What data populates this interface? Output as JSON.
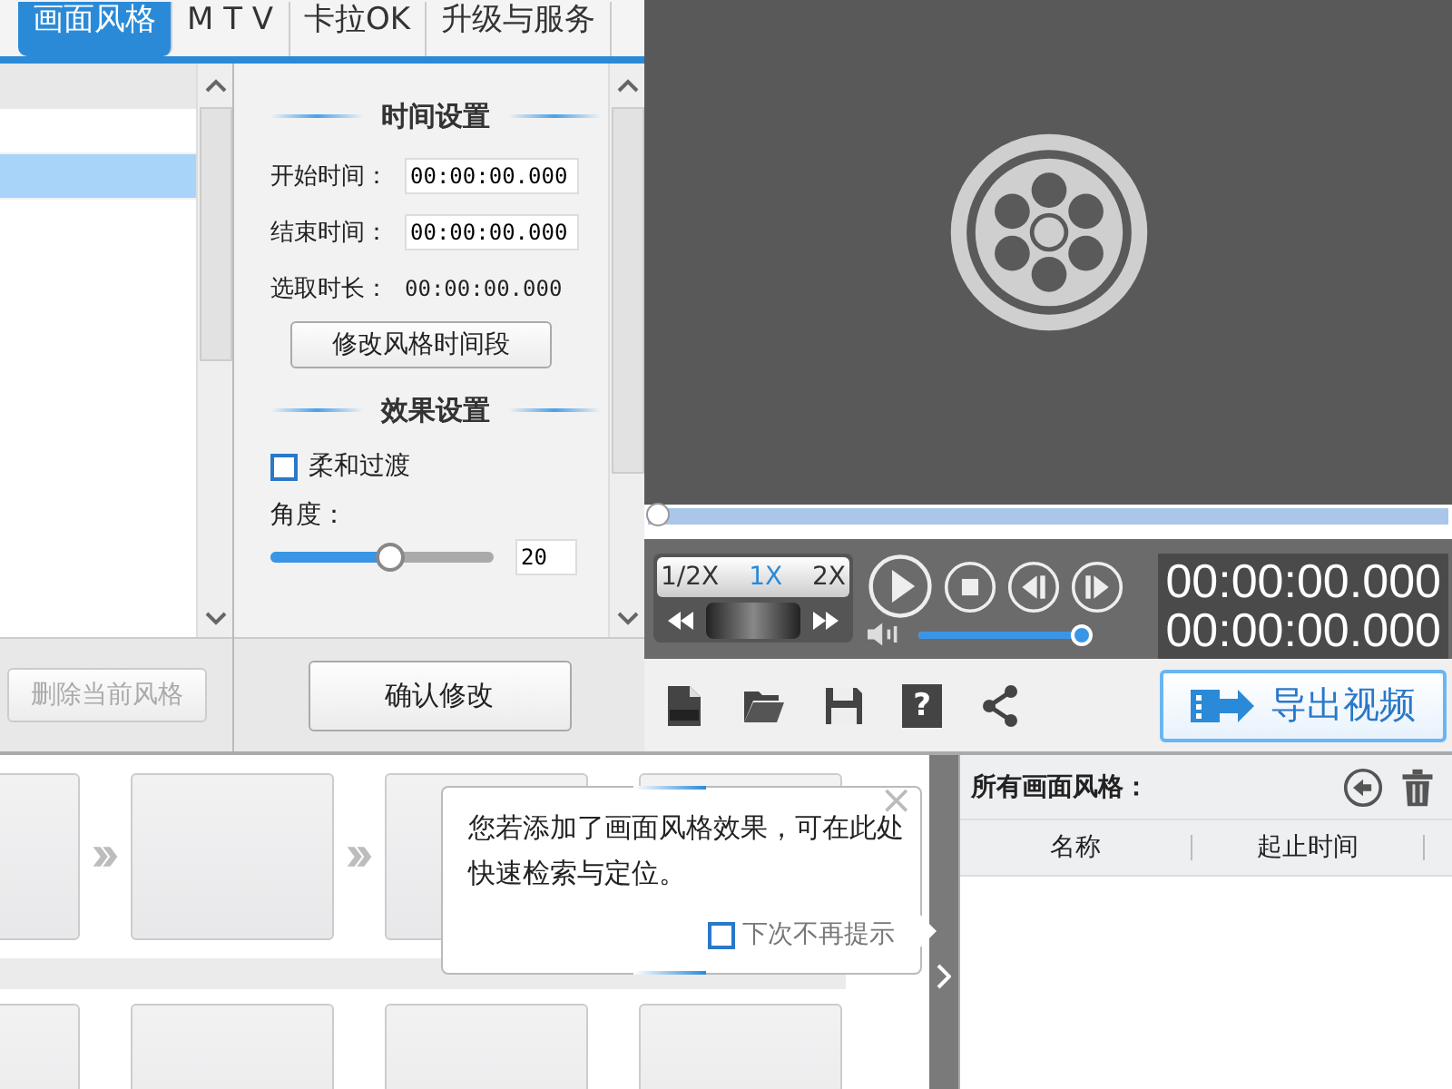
{
  "tabs": [
    {
      "label": "画面风格",
      "selected": true
    },
    {
      "label": "M T V",
      "selected": false
    },
    {
      "label": "卡拉OK",
      "selected": false
    },
    {
      "label": "升级与服务",
      "selected": false
    }
  ],
  "style_list": {
    "rows": [
      {
        "selected": false
      },
      {
        "selected": true
      }
    ],
    "delete_button": {
      "label": "删除当前风格",
      "disabled": true
    }
  },
  "time_settings": {
    "title": "时间设置",
    "start": {
      "label": "开始时间：",
      "value": "00:00:00.000"
    },
    "end": {
      "label": "结束时间：",
      "value": "00:00:00.000"
    },
    "duration": {
      "label": "选取时长：",
      "value": "00:00:00.000"
    },
    "button": "修改风格时间段"
  },
  "effect_settings": {
    "title": "效果设置",
    "soft_transition": {
      "label": "柔和过渡",
      "checked": false
    },
    "angle": {
      "label": "角度：",
      "level": 0.54,
      "value": "20"
    }
  },
  "confirm_button": "确认修改",
  "player": {
    "seek": {
      "level": 0
    },
    "speeds": [
      {
        "label": "1/2X",
        "selected": false
      },
      {
        "label": "1X",
        "selected": true
      },
      {
        "label": "2X",
        "selected": false
      }
    ],
    "volume": {
      "level": 0.96
    },
    "time_current": "00:00:00.000",
    "time_total": "00:00:00.000"
  },
  "export_button": "导出视频",
  "help_glyph": "?",
  "tooltip": {
    "text": "您若添加了画面风格效果，可在此处快速检索与定位。",
    "close": "×",
    "dont_show": {
      "label": "下次不再提示",
      "checked": false
    }
  },
  "style_panel": {
    "title": "所有画面风格：",
    "columns": [
      "名称",
      "起止时间"
    ]
  }
}
